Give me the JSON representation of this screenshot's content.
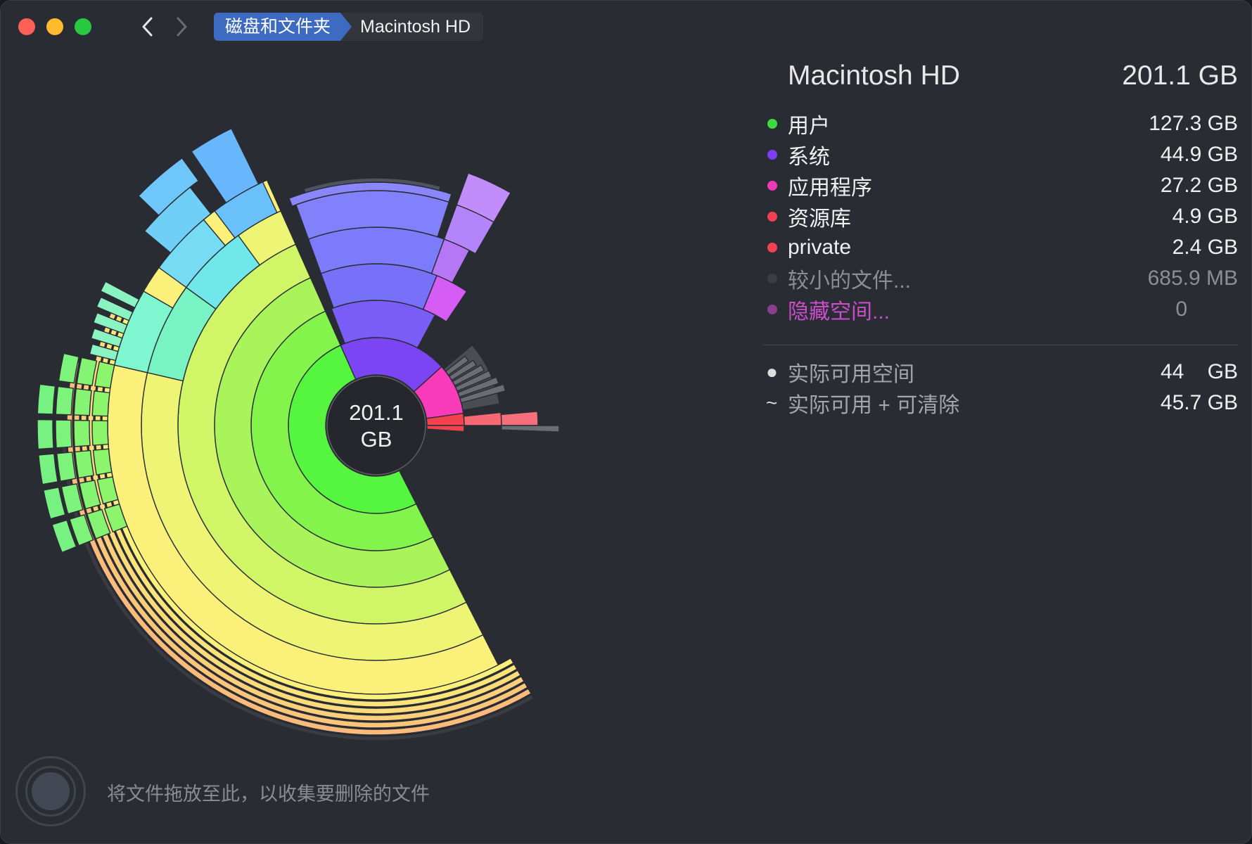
{
  "titlebar": {
    "breadcrumb": [
      "磁盘和文件夹",
      "Macintosh HD"
    ]
  },
  "sunburst": {
    "center_value": "201.1",
    "center_unit": "GB"
  },
  "info": {
    "title": "Macintosh HD",
    "total": "201.1 GB",
    "items": [
      {
        "label": "用户",
        "value": "127.3 GB",
        "color": "#3fdc3f"
      },
      {
        "label": "系统",
        "value": "44.9 GB",
        "color": "#7b3ef2"
      },
      {
        "label": "应用程序",
        "value": "27.2 GB",
        "color": "#f039b6"
      },
      {
        "label": "资源库",
        "value": "4.9 GB",
        "color": "#f04150"
      },
      {
        "label": "private",
        "value": "2.4 GB",
        "color": "#f2424f"
      },
      {
        "label": "较小的文件...",
        "value": "685.9 MB",
        "color": "#3b3d44"
      },
      {
        "label": "隐藏空间...",
        "value": "0",
        "color": "#8a3e8e"
      }
    ],
    "free": [
      {
        "symbol": "●",
        "label": "实际可用空间",
        "value": "44    GB"
      },
      {
        "symbol": "~",
        "label": "实际可用 + 可清除",
        "value": "45.7 GB"
      }
    ]
  },
  "drop_zone": {
    "text": "将文件拖放至此，以收集要删除的文件"
  }
}
